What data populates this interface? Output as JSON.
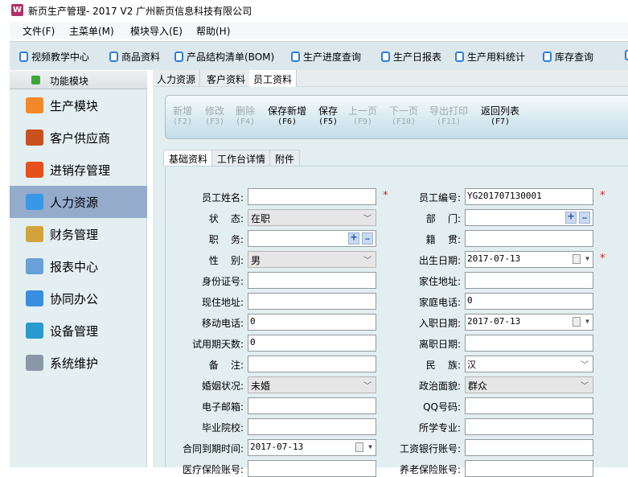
{
  "app": {
    "title": "新页生产管理- 2017 V2 广州新页信息科技有限公司",
    "icon": "W"
  },
  "menu": [
    "文件(F)",
    "主菜单(M)",
    "模块导入(E)",
    "帮助(H)"
  ],
  "toolbar": [
    "视频教学中心",
    "商品资料",
    "产品结构清单(BOM)",
    "生产进度查询",
    "生产日报表",
    "生产用料统计",
    "库存查询"
  ],
  "sidebar": {
    "header": "功能模块",
    "items": [
      {
        "label": "生产模块",
        "icon": "folder-icon",
        "color": "#f4892a"
      },
      {
        "label": "客户供应商",
        "icon": "users-icon",
        "color": "#c8501f"
      },
      {
        "label": "进销存管理",
        "icon": "bar-chart-icon",
        "color": "#e5501c"
      },
      {
        "label": "人力资源",
        "icon": "person-icon",
        "color": "#3a97e8",
        "selected": true
      },
      {
        "label": "财务管理",
        "icon": "coins-icon",
        "color": "#d2a33a"
      },
      {
        "label": "报表中心",
        "icon": "report-icon",
        "color": "#6aa0d8"
      },
      {
        "label": "协同办公",
        "icon": "calendar-icon",
        "color": "#3a8ee0"
      },
      {
        "label": "设备管理",
        "icon": "device-icon",
        "color": "#2a9ad0"
      },
      {
        "label": "系统维护",
        "icon": "lock-icon",
        "color": "#8a98a6"
      }
    ]
  },
  "tabs": [
    "人力资源",
    "客户资料",
    "员工资料"
  ],
  "actions": [
    {
      "label": "新增",
      "key": "(F2)",
      "enabled": false
    },
    {
      "label": "修改",
      "key": "(F3)",
      "enabled": false
    },
    {
      "label": "删除",
      "key": "(F4)",
      "enabled": false
    },
    {
      "label": "保存新增",
      "key": "(F6)",
      "enabled": true
    },
    {
      "label": "保存",
      "key": "(F5)",
      "enabled": true
    },
    {
      "label": "上一页",
      "key": "(F9)",
      "enabled": false
    },
    {
      "label": "下一页",
      "key": "(F10)",
      "enabled": false
    },
    {
      "label": "导出打印",
      "key": "(F11)",
      "enabled": false
    },
    {
      "label": "返回列表",
      "key": "(F7)",
      "enabled": true
    }
  ],
  "subtabs": [
    "基础资料",
    "工作台详情",
    "附件"
  ],
  "form": {
    "left": [
      {
        "label": "员工姓名:",
        "value": "",
        "type": "text",
        "required": true
      },
      {
        "label": "状    态:",
        "value": "在职",
        "type": "select"
      },
      {
        "label": "职    务:",
        "value": "",
        "type": "lookup"
      },
      {
        "label": "性    别:",
        "value": "男",
        "type": "select"
      },
      {
        "label": "身份证号:",
        "value": "",
        "type": "text"
      },
      {
        "label": "现住地址:",
        "value": "",
        "type": "text"
      },
      {
        "label": "移动电话:",
        "value": "0",
        "type": "text"
      },
      {
        "label": "试用期天数:",
        "value": "0",
        "type": "text"
      },
      {
        "label": "备    注:",
        "value": "",
        "type": "text"
      },
      {
        "label": "婚姻状况:",
        "value": "未婚",
        "type": "select"
      },
      {
        "label": "电子邮箱:",
        "value": "",
        "type": "text"
      },
      {
        "label": "毕业院校:",
        "value": "",
        "type": "text"
      },
      {
        "label": "合同到期时间:",
        "value": "2017-07-13",
        "type": "date"
      },
      {
        "label": "医疗保险账号:",
        "value": "",
        "type": "text"
      }
    ],
    "right": [
      {
        "label": "员工编号:",
        "value": "YG201707130001",
        "type": "text",
        "required": true
      },
      {
        "label": "部    门:",
        "value": "",
        "type": "lookup"
      },
      {
        "label": "籍    贯:",
        "value": "",
        "type": "text"
      },
      {
        "label": "出生日期:",
        "value": "2017-07-13",
        "type": "date",
        "required": true
      },
      {
        "label": "家住地址:",
        "value": "",
        "type": "text"
      },
      {
        "label": "家庭电话:",
        "value": "0",
        "type": "text"
      },
      {
        "label": "入职日期:",
        "value": "2017-07-13",
        "type": "date"
      },
      {
        "label": "离职日期:",
        "value": "",
        "type": "text"
      },
      {
        "label": "民    族:",
        "value": "汉",
        "type": "combo"
      },
      {
        "label": "政治面貌:",
        "value": "群众",
        "type": "select"
      },
      {
        "label": "QQ号码:",
        "value": "",
        "type": "text"
      },
      {
        "label": "所学专业:",
        "value": "",
        "type": "text"
      },
      {
        "label": "工资银行账号:",
        "value": "",
        "type": "text"
      },
      {
        "label": "养老保险账号:",
        "value": "",
        "type": "text"
      }
    ]
  },
  "required_mark": "*"
}
